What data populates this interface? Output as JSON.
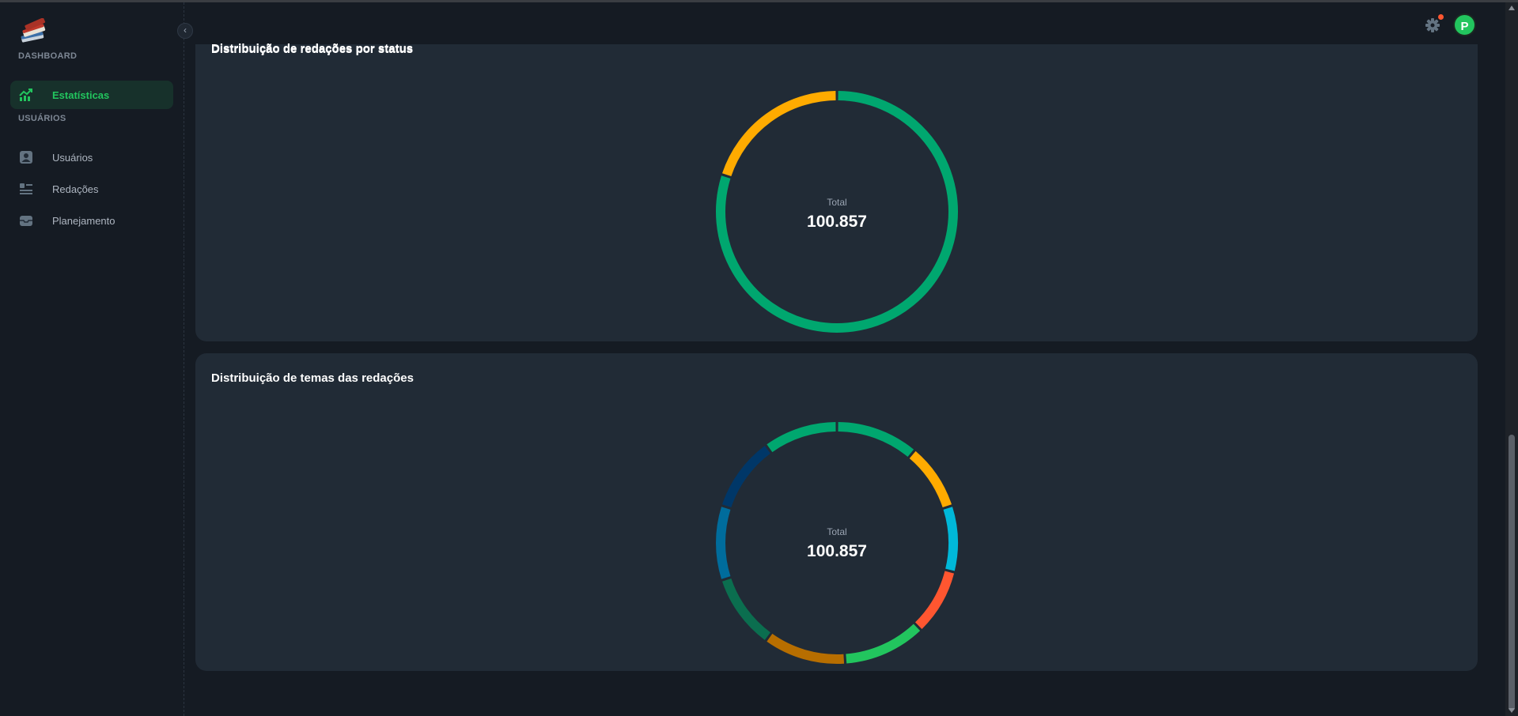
{
  "sidebar": {
    "sections": [
      {
        "label": "DASHBOARD"
      },
      {
        "label": "USUÁRIOS"
      }
    ],
    "items": [
      {
        "label": "Estatísticas",
        "icon": "trending-up-icon",
        "active": true
      },
      {
        "label": "Usuários",
        "icon": "user-card-icon",
        "active": false
      },
      {
        "label": "Redações",
        "icon": "document-list-icon",
        "active": false
      },
      {
        "label": "Planejamento",
        "icon": "inbox-icon",
        "active": false
      }
    ],
    "collapse_icon": "chevron-left-icon"
  },
  "header": {
    "avatar_letter": "P",
    "settings_icon": "gear-icon"
  },
  "cards": [
    {
      "title": "Distribuição de redações por status",
      "total_label": "Total",
      "total_value": "100.857"
    },
    {
      "title": "Distribuição de temas das redações",
      "total_label": "Total",
      "total_value": "100.857"
    }
  ],
  "colors": {
    "accent": "#22c55e",
    "card_bg": "#212b36",
    "page_bg": "#151b23"
  },
  "chart_data": [
    {
      "type": "pie",
      "values": [
        80,
        20
      ],
      "colors": [
        "#00a76f",
        "#ffab00"
      ]
    },
    {
      "type": "pie",
      "values": [
        10,
        8,
        8,
        8,
        10,
        10,
        9,
        9,
        9,
        9
      ],
      "colors": [
        "#00a76f",
        "#ffab00",
        "#00b8d9",
        "#ff5630",
        "#22c55e",
        "#b76e00",
        "#0b6e4f",
        "#006c9c",
        "#003768",
        "#00a76f"
      ]
    }
  ]
}
